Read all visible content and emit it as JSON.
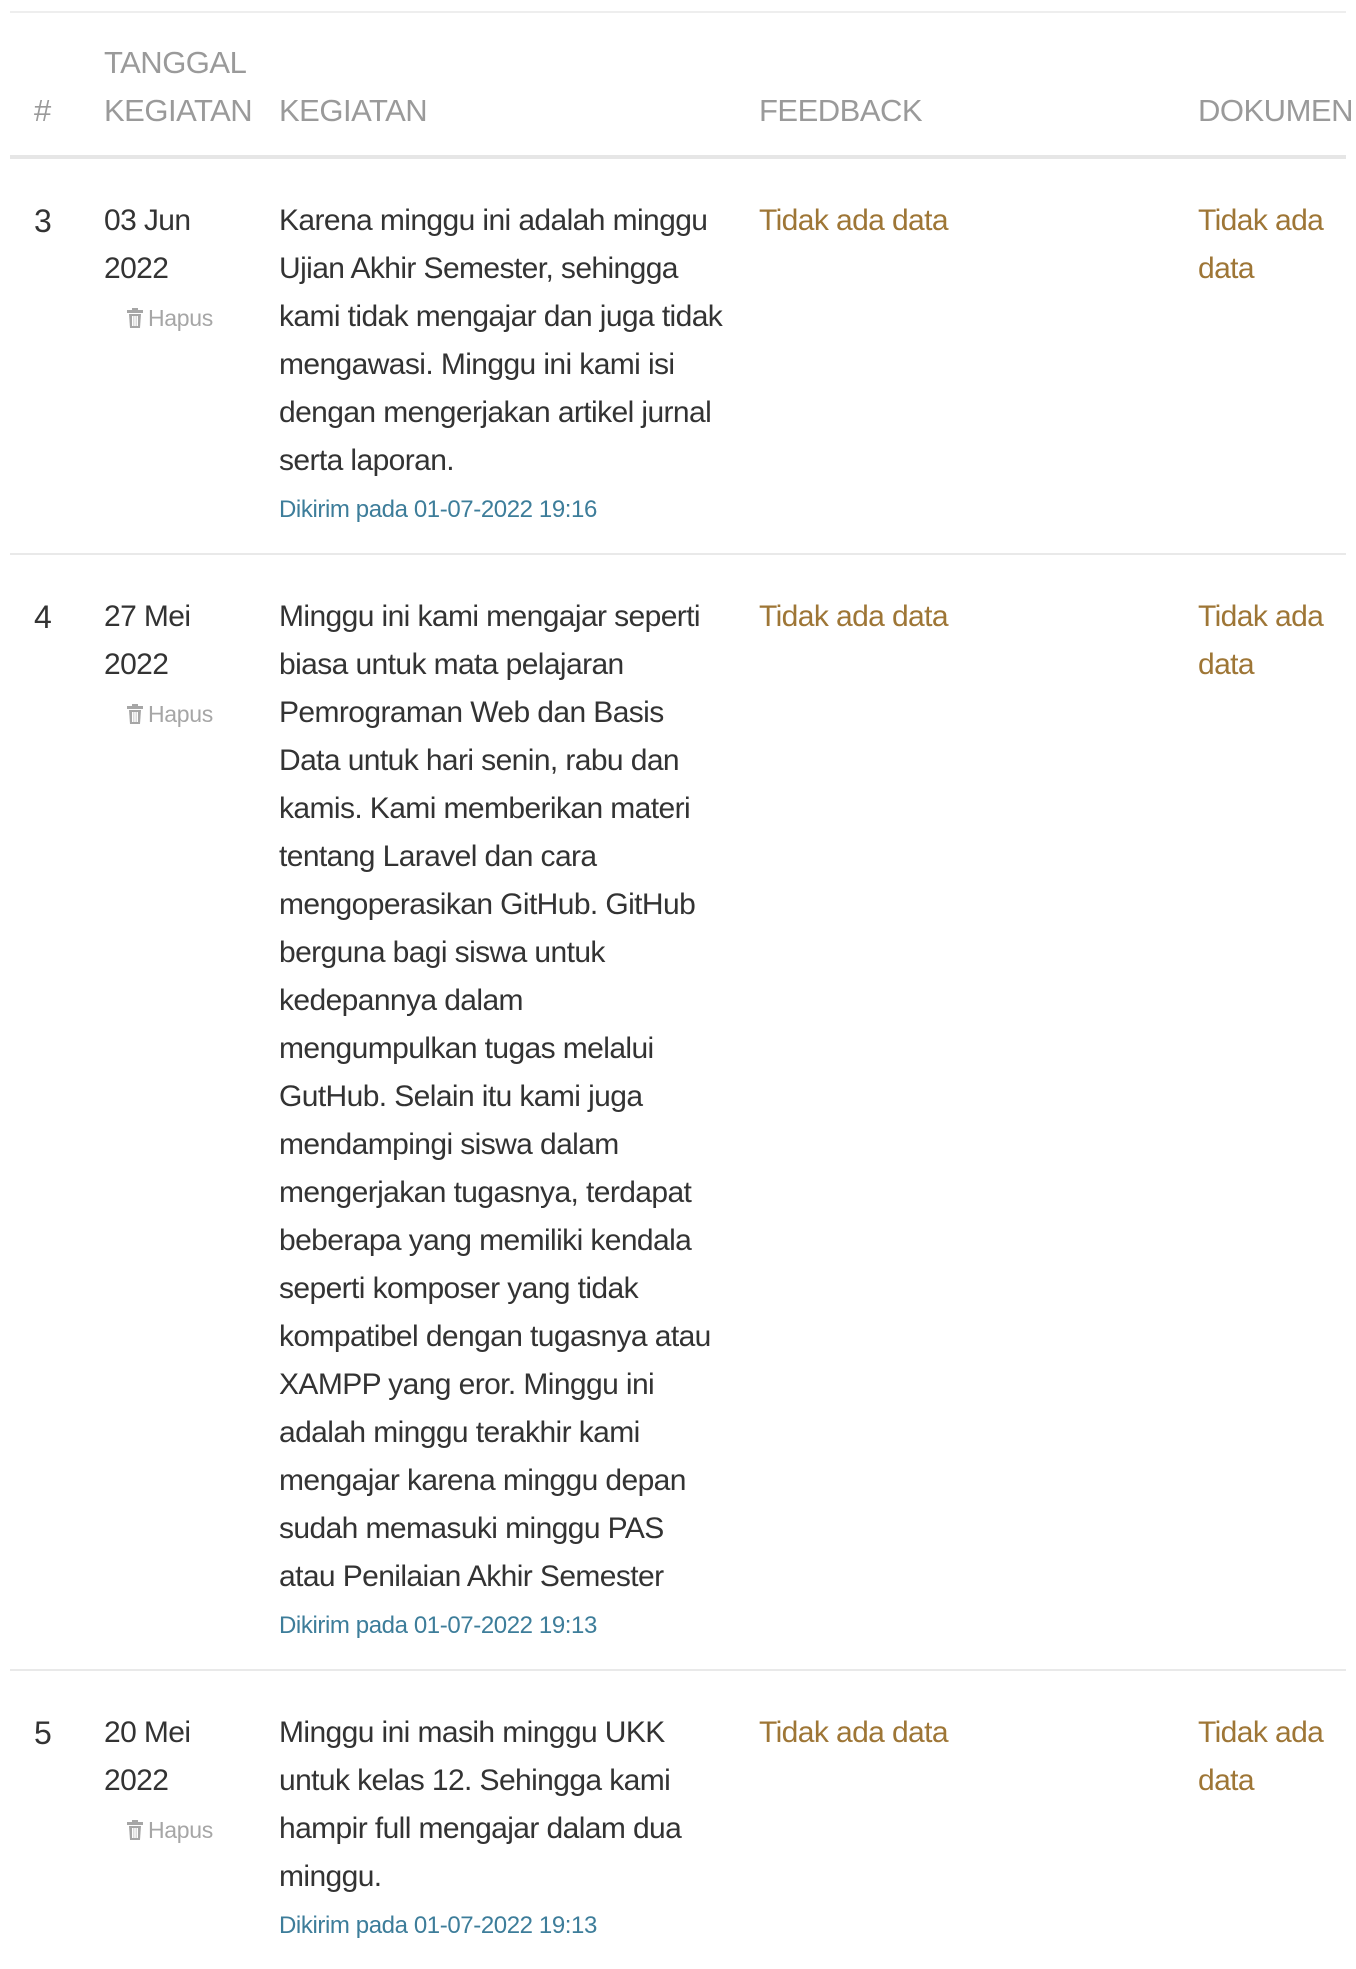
{
  "table": {
    "headers": {
      "num": "#",
      "date": "TANGGAL KEGIATAN",
      "activity": "KEGIATAN",
      "feedback": "FEEDBACK",
      "document": "DOKUMEN"
    },
    "rows": [
      {
        "num": "3",
        "date": "03 Jun\n2022",
        "delete_label": "Hapus",
        "activity": "Karena minggu ini adalah minggu Ujian Akhir Semester, sehingga kami tidak mengajar dan juga tidak mengawasi. Minggu ini kami isi dengan mengerjakan artikel jurnal serta laporan.",
        "sent_at": "Dikirim pada 01-07-2022 19:16",
        "feedback": "Tidak ada data",
        "document": "Tidak ada data"
      },
      {
        "num": "4",
        "date": "27 Mei\n2022",
        "delete_label": "Hapus",
        "activity": "Minggu ini kami mengajar seperti biasa untuk mata pelajaran Pemrograman Web dan Basis Data untuk hari senin, rabu dan kamis. Kami memberikan materi tentang Laravel dan cara mengoperasikan GitHub. GitHub berguna bagi siswa untuk kedepannya dalam mengumpulkan tugas melalui GutHub. Selain itu kami juga mendampingi siswa dalam mengerjakan tugasnya, terdapat beberapa yang memiliki kendala seperti komposer yang tidak kompatibel dengan tugasnya atau XAMPP yang eror. Minggu ini adalah minggu terakhir kami mengajar karena minggu depan sudah memasuki minggu PAS atau Penilaian Akhir Semester",
        "sent_at": "Dikirim pada 01-07-2022 19:13",
        "feedback": "Tidak ada data",
        "document": "Tidak ada data"
      },
      {
        "num": "5",
        "date": "20 Mei\n2022",
        "delete_label": "Hapus",
        "activity": "Minggu ini masih minggu UKK untuk kelas 12. Sehingga kami hampir full mengajar dalam dua minggu.",
        "sent_at": "Dikirim pada 01-07-2022 19:13",
        "feedback": "Tidak ada data",
        "document": "Tidak ada data"
      }
    ]
  },
  "colors": {
    "header_text": "#9a9a9a",
    "body_text": "#333333",
    "nodata_text": "#9e7636",
    "timestamp_text": "#3d7d9a",
    "delete_text": "#a6a6a6"
  },
  "icons": {
    "delete": "trash-icon"
  }
}
